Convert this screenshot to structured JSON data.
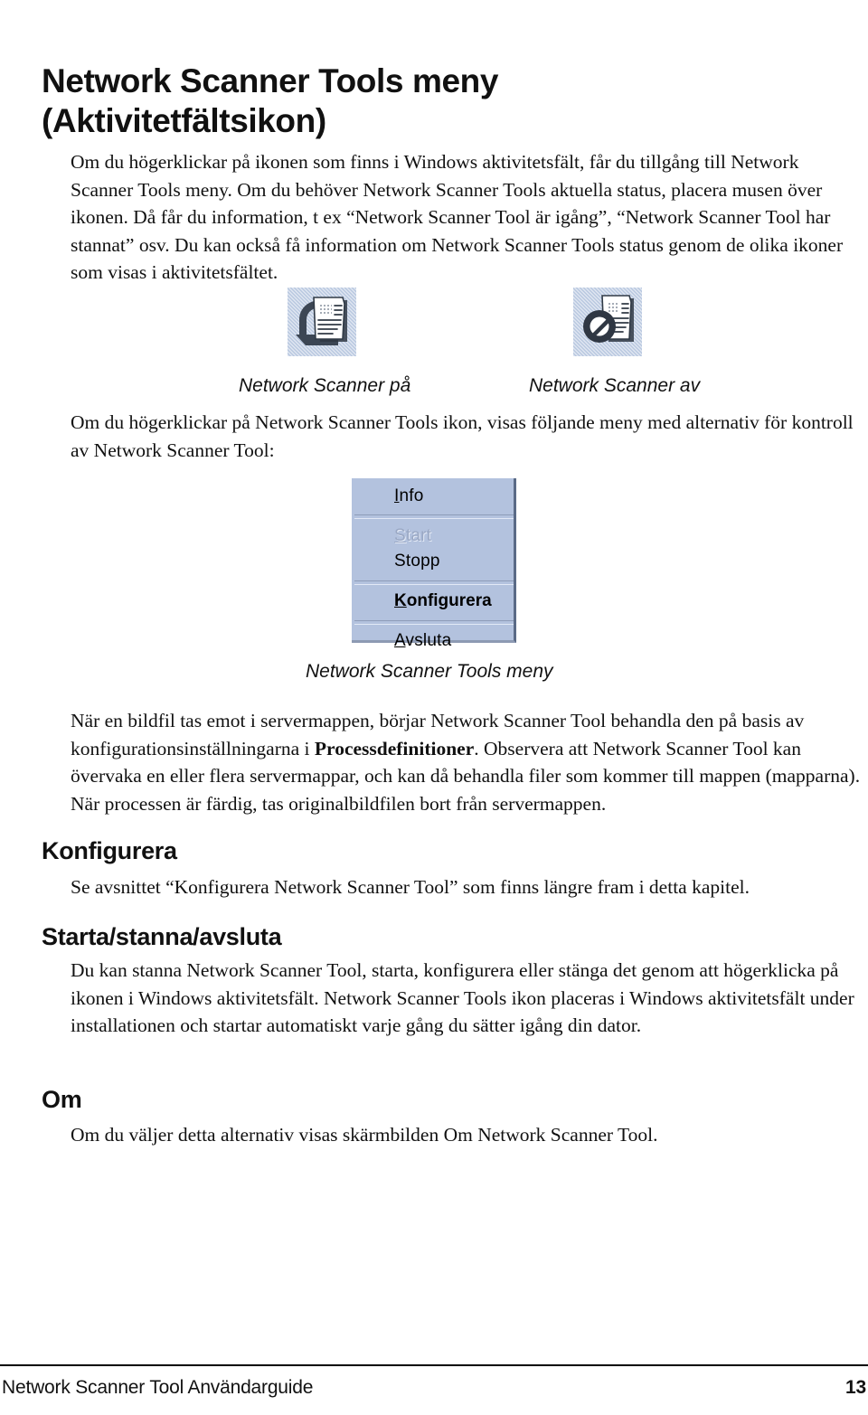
{
  "document": {
    "title_line1": "Network Scanner Tools meny",
    "title_line2": "(Aktivitetfältsikon)"
  },
  "intro_paragraph": "Om du högerklickar på ikonen som finns i Windows aktivitetsfält, får du tillgång till Network Scanner Tools meny. Om du behöver Network Scanner Tools aktuella status, placera musen över ikonen. Då får du information, t ex “Network Scanner Tool är igång”, “Network Scanner Tool har stannat” osv. Du kan också få information om Network Scanner Tools status genom de olika ikoner som visas i aktivitetsfältet.",
  "tray_icons": {
    "on": {
      "icon_name": "network-scanner-on-icon",
      "caption": "Network Scanner på"
    },
    "off": {
      "icon_name": "network-scanner-off-icon",
      "caption": "Network Scanner av"
    }
  },
  "menu_intro_paragraph": "Om du högerklickar på Network Scanner Tools ikon, visas följande meny med alternativ för kontroll av Network Scanner Tool:",
  "context_menu": {
    "caption": "Network Scanner Tools meny",
    "background_color": "#b3c2de",
    "items": [
      {
        "label_before": "I",
        "label_after": "nfo",
        "accelerator": "I",
        "state": "enabled",
        "emphasis": "normal"
      },
      {
        "label_before": "S",
        "label_after": "tart",
        "accelerator": "S",
        "state": "disabled",
        "emphasis": "normal"
      },
      {
        "label_before": "St",
        "label_after": "opp",
        "accelerator": "o",
        "state": "enabled",
        "emphasis": "normal"
      },
      {
        "label_before": "K",
        "label_after": "onfigurera",
        "accelerator": "K",
        "state": "enabled",
        "emphasis": "bold"
      },
      {
        "label_before": "A",
        "label_after": "vsluta",
        "accelerator": "A",
        "state": "enabled",
        "emphasis": "normal"
      }
    ],
    "item_labels": {
      "info": "Info",
      "start": "Start",
      "stopp": "Stopp",
      "konfigurera": "Konfigurera",
      "avsluta": "Avsluta"
    },
    "accelerators": {
      "info_pre": "I",
      "info_post": "nfo",
      "start_pre": "S",
      "start_post": "tart",
      "stopp_pre": "St",
      "stopp_post": "opp",
      "konfigurera_pre": "K",
      "konfigurera_post": "onfigurera",
      "avsluta_pre": "A",
      "avsluta_post": "vsluta"
    }
  },
  "process_paragraph": {
    "part1": "När en bildfil tas emot i servermappen, börjar Network Scanner Tool behandla den på basis av konfigurationsinställningarna i ",
    "bold": "Processdefinitioner",
    "part2": ". Observera att Network Scanner Tool kan övervaka en eller flera servermappar, och kan då behandla filer som kommer till mappen (mapparna).  När processen är färdig, tas originalbildfilen bort från servermappen."
  },
  "sections": {
    "konfigurera": {
      "heading": "Konfigurera",
      "body": "Se avsnittet “Konfigurera Network Scanner Tool” som finns längre fram i detta kapitel."
    },
    "starta": {
      "heading": "Starta/stanna/avsluta",
      "body": "Du kan stanna Network Scanner Tool, starta, konfigurera eller stänga det genom att högerklicka på ikonen i Windows aktivitetsfält. Network Scanner Tools ikon placeras i Windows aktivitetsfält under installationen och startar automatiskt varje gång du sätter igång din dator."
    },
    "om": {
      "heading": "Om",
      "body": "Om du väljer detta alternativ visas skärmbilden Om Network Scanner Tool."
    }
  },
  "footer": {
    "left": "Network Scanner Tool Användarguide",
    "page_number": "13"
  }
}
